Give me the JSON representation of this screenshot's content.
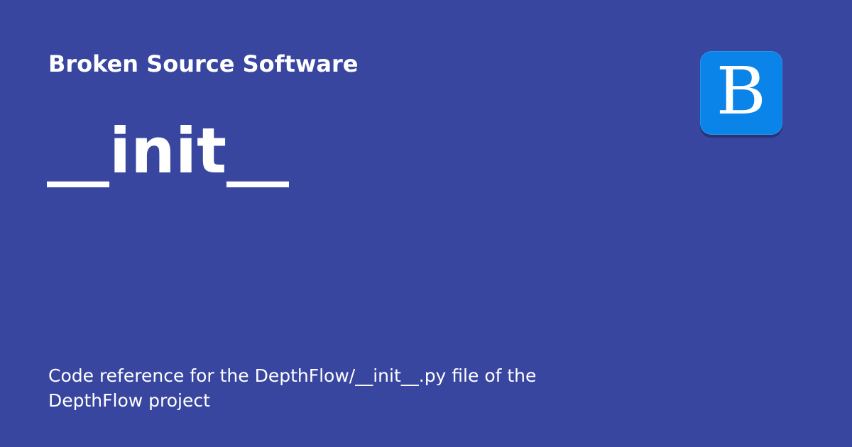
{
  "card": {
    "background_color": "#3946a0",
    "site_name": "Broken Source Software",
    "page_title": "__init__",
    "description": "Code reference for the DepthFlow/__init__.py file of the DepthFlow project",
    "logo": {
      "icon": "blue-b-logo-icon",
      "letter": "B",
      "background_color": "#0a84e8"
    }
  }
}
